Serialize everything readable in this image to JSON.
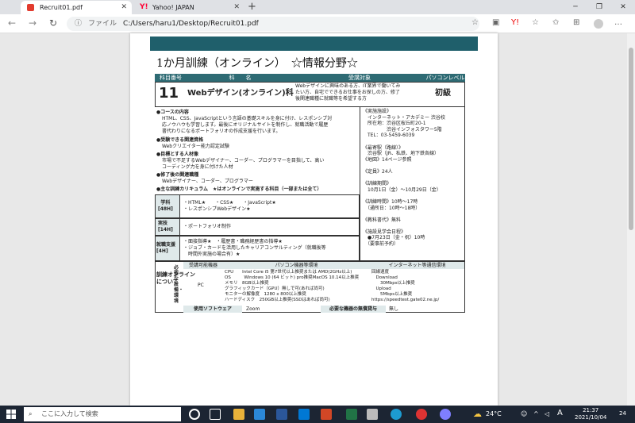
{
  "tabs": [
    {
      "label": "Recruit01.pdf",
      "color": "#e23b2e"
    },
    {
      "label": "Yahoo! JAPAN",
      "color": "#ff0033"
    }
  ],
  "address": {
    "scheme": "ファイル",
    "path": "C:/Users/haru1/Desktop/Recruit01.pdf"
  },
  "doc": {
    "title": "1か月訓練（オンライン）　☆情報分野☆",
    "h_num": "科目番号",
    "h_name": "科　　名",
    "h_target": "受講対象",
    "h_level": "パソコンレベル",
    "num": "11",
    "course": "Webデザイン(オンライン)科",
    "target": "Webデザインに興味のある方、IT業界で働いてみ\nたい方、自宅でできるお仕事をお探しの方、修了\n後関連職種に就職等を希望する方",
    "level": "初級",
    "outline_h": "●コースの内容",
    "outline": "HTML、CSS、JavaScriptという言語の基礎スキルを身に付け、レスポンシブ対\n応ノウハウも学習します。最後にオリジナルサイトを制作し、就職活動で履歴\n書代わりになるポートフォリオの作成支援を行います。",
    "qual_h": "●受験できる関連資格",
    "qual": "Webクリエイター能力認定試験",
    "goal_h": "●目標とする人材像",
    "goal": "市場で不足するWebデザイナー、コーダー、プログラマーを目指して、高い\nコーディング力を身に付けた人材",
    "job_h": "●修了後の関連職種",
    "job": "Webデザイナー、コーダー、プログラマー",
    "cur_h": "●主な訓練カリキュラム　★はオンラインで実施する科目（一部または全て）",
    "rows": [
      {
        "label": "学科\n[48H]",
        "text": "・HTML★　　・CSS★　　・JavaScript★\n・レスポンシブWebデザイン★"
      },
      {
        "label": "実技\n[14H]",
        "text": "・ポートフォリオ制作"
      },
      {
        "label": "就職支援\n[4H]",
        "text": "・面接指導★　・履歴書・職務経歴書の指導★\n・ジョブ・カードを活用したキャリアコンサルティング（就職後等\n　時間外実施の場合有）★"
      }
    ],
    "right": "《実施施設》\n　インターネット・アカデミー 渋谷校\n　所在地：渋谷区桜丘町20-1\n　　　　　渋谷インフォスタワー5階\n　TEL：03-5459-6039\n\n《最寄駅（路線）》\n　渋谷駅（JR、私鉄、地下鉄各線）\n《地図》14ページ参照\n\n《定員》24人\n\n《訓練期間》\n　10月1日（金）～10月29日（金）\n\n《訓練時間》10時～17時\n　（通所日：10時～18時）\n\n《教科書代》無料\n\n《施設見学会日程》\n　●7月23日（金・祝）10時\n　（要事前予約）",
    "env": {
      "side": "訓練オンライン\nについて",
      "req": "必要な設備・環境",
      "h1": "受講可能機器",
      "h2": "パソコン機器等環境",
      "h3": "インターネット等通信環境",
      "pc": "PC",
      "spec": "CPU　　Intel Core i5 第7世代以上推奨または AMD(2GHz以上)\nOS　　　Windows 10 (64 ビット) pro推奨MacOS 10.14以上推奨\nメモリ　8GB以上推奨\nグラフィックカード（GPU）無しで可(あれば尚可)\nモニターの解像度　1280 x 800以上推奨\nハードディスク　250GB以上推奨(SSDはあれば尚可)",
      "net": "回線速度\n　Download\n　　30Mbps以上推奨\n　Upload\n　　5Mbps以上推奨\nhttps://speedtest.gate02.ne.jp/",
      "sw_h": "使用ソフトウェア",
      "sw": "Zoom",
      "need_h": "必要な機器の無償貸与",
      "need": "無し"
    }
  },
  "taskbar": {
    "search": "ここに入力して検索",
    "temp": "24°C",
    "ime": "A",
    "time": "21:37",
    "date": "2021/10/04",
    "badge": "24"
  }
}
